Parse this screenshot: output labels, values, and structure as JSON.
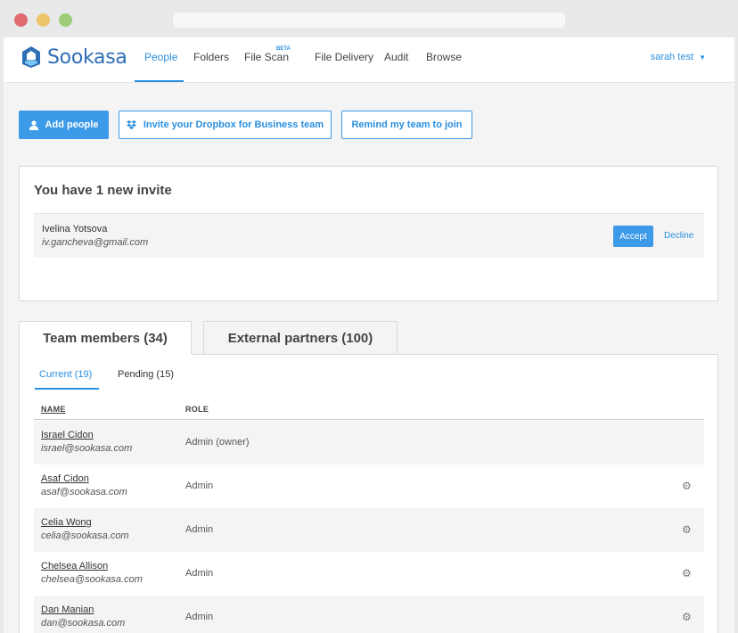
{
  "nav": {
    "brand": "Sookasa",
    "items": [
      {
        "label": "People",
        "active": true
      },
      {
        "label": "Folders",
        "active": false
      },
      {
        "label": "File Scan",
        "active": false,
        "badge": "BETA"
      },
      {
        "label": "File Delivery",
        "active": false
      },
      {
        "label": "Audit",
        "active": false
      },
      {
        "label": "Browse",
        "active": false
      }
    ],
    "user": "sarah test"
  },
  "actions": {
    "add_people": "Add people",
    "invite_dropbox": "Invite your Dropbox for Business team",
    "remind": "Remind my team to join"
  },
  "invite": {
    "title": "You have 1 new invite",
    "name": "Ivelina Yotsova",
    "email": "iv.gancheva@gmail.com",
    "accept": "Accept",
    "decline": "Decline"
  },
  "tabs": {
    "team": "Team members (34)",
    "external": "External partners (100)"
  },
  "subtabs": {
    "current": "Current (19)",
    "pending": "Pending (15)"
  },
  "table": {
    "headers": {
      "name": "NAME",
      "role": "ROLE"
    },
    "rows": [
      {
        "name": "Israel Cidon",
        "email": "israel@sookasa.com",
        "role": "Admin (owner)"
      },
      {
        "name": "Asaf Cidon",
        "email": "asaf@sookasa.com",
        "role": "Admin"
      },
      {
        "name": "Celia Wong",
        "email": "celia@sookasa.com",
        "role": "Admin"
      },
      {
        "name": "Chelsea Allison",
        "email": "chelsea@sookasa.com",
        "role": "Admin"
      },
      {
        "name": "Dan Manian",
        "email": "dan@sookasa.com",
        "role": "Admin"
      }
    ]
  },
  "colors": {
    "accent": "#2a8fe0",
    "primary_button": "#3d9ae8",
    "brand": "#2f6fb6"
  }
}
